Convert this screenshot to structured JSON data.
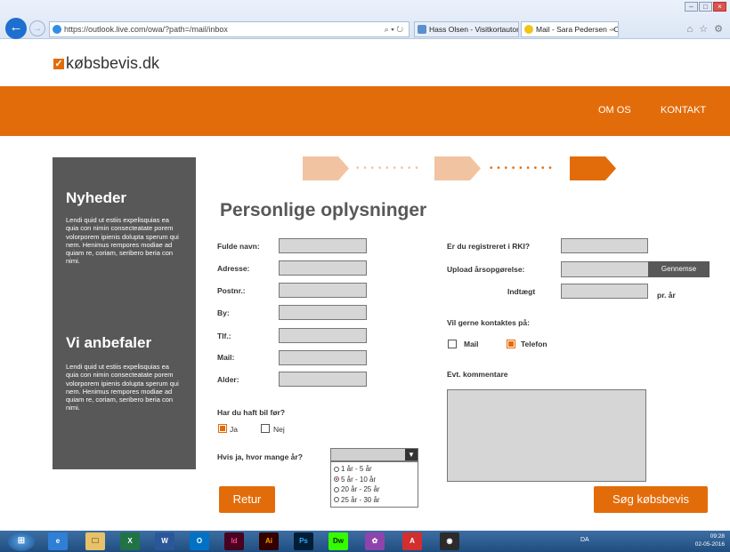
{
  "browser": {
    "address_url": "https://outlook.live.com/owa/?path=/mail/inbox",
    "address_tools": "⌕ ▾ ↻",
    "tabs": [
      {
        "label": "Hass Olsen - Visitkortautomat"
      },
      {
        "label": "Mail - Sara Pedersen - Outl...",
        "close": "×"
      }
    ],
    "window_controls": [
      "–",
      "□",
      "×"
    ],
    "icons_right": "⌂ ☆ ⚙"
  },
  "site": {
    "logo": "købsbevis.dk",
    "logo_mark": "✓",
    "nav": {
      "about": "OM OS",
      "contact": "KONTAKT"
    },
    "accent_color": "#e36c0a",
    "sidebar": {
      "news_heading": "Nyheder",
      "news_text": "Lendi quid ut estiis expelisquias ea quia con nimin consecteatate porem volorporem ipienis dolupta sperum qui nem. Henimus rempores modiae ad quiam re, coriam, seribero beria con nimi.",
      "recommend_heading": "Vi anbefaler",
      "recommend_text": "Lendi quid ut estiis expelisquias ea quia con nimin consecteatate porem volorporem ipienis dolupta sperum qui nem. Henimus rempores modiae ad quiam re, coriam, seribero beria con nimi."
    },
    "steps": {
      "current": 3,
      "total": 3
    }
  },
  "form": {
    "title": "Personlige oplysninger",
    "left_fields": [
      {
        "label": "Fulde navn:",
        "value": ""
      },
      {
        "label": "Adresse:",
        "value": ""
      },
      {
        "label": "Postnr.:",
        "value": ""
      },
      {
        "label": "By:",
        "value": ""
      },
      {
        "label": "Tlf.:",
        "value": ""
      },
      {
        "label": "Mail:",
        "value": ""
      },
      {
        "label": "Alder:",
        "value": ""
      }
    ],
    "car_question": "Har du haft bil før?",
    "car_yes": "Ja",
    "car_no": "Nej",
    "car_yes_checked": true,
    "years_question": "Hvis ja, hvor mange år?",
    "years_options": [
      "1 år - 5 år",
      "5 år - 10 år",
      "20 år - 25 år",
      "25 år - 30 år"
    ],
    "years_selected_index": 1,
    "rki_label": "Er du registreret i RKI?",
    "upload_label": "Upload årsopgørelse:",
    "browse_button": "Gennemse",
    "income_label": "Indtægt",
    "income_suffix": "pr. år",
    "contact_label": "Vil gerne kontaktes på:",
    "contact_mail": "Mail",
    "contact_phone": "Telefon",
    "contact_phone_checked": true,
    "comment_label": "Evt. kommentare",
    "back_button": "Retur",
    "submit_button": "Søg købsbevis"
  },
  "taskbar": {
    "items": [
      "e",
      "🗀",
      "X",
      "W",
      "O",
      "Id",
      "Ai",
      "Ps",
      "Dw",
      "✿",
      "A",
      "◉"
    ],
    "language": "DA",
    "time": "09:28",
    "date": "02-05-2016"
  }
}
